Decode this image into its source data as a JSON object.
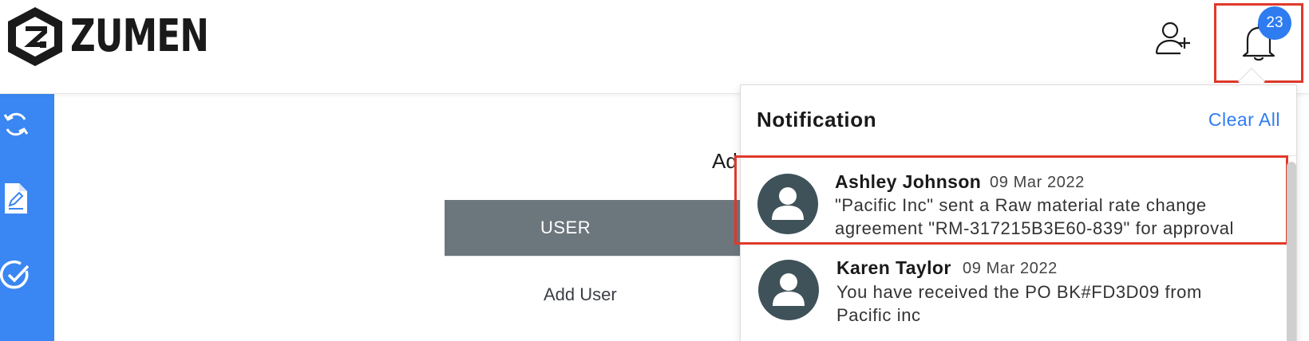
{
  "header": {
    "brand": "ZUMEN",
    "logo_mark": "Z",
    "notification_count": "23",
    "icons": {
      "logo": "zumen-hexagon-logo-icon",
      "add_user": "add-user-icon",
      "bell": "bell-icon"
    }
  },
  "sidebar": {
    "items": [
      {
        "icon": "refresh-icon"
      },
      {
        "icon": "document-edit-icon"
      },
      {
        "icon": "check-circle-icon"
      }
    ]
  },
  "main": {
    "heading": "Ad",
    "table": {
      "columns": [
        "USER"
      ],
      "rows": [
        [
          "Add User"
        ]
      ]
    }
  },
  "notifications": {
    "title": "Notification",
    "clear_label": "Clear All",
    "items": [
      {
        "sender": "Ashley Johnson",
        "date": "09 Mar 2022",
        "message_lines": [
          "\"Pacific Inc\" sent a Raw material rate change",
          "agreement \"RM-317215B3E60-839\" for approval"
        ]
      },
      {
        "sender": "Karen Taylor",
        "date": "09 Mar 2022",
        "message_lines": [
          "You have received the PO BK#FD3D09 from",
          "Pacific inc"
        ]
      }
    ]
  },
  "colors": {
    "accent": "#2f7cf0",
    "sidebar": "#3a86f2",
    "table_header": "#6c767d",
    "highlight_border": "#e0392b",
    "avatar_bg": "#3f5259"
  }
}
